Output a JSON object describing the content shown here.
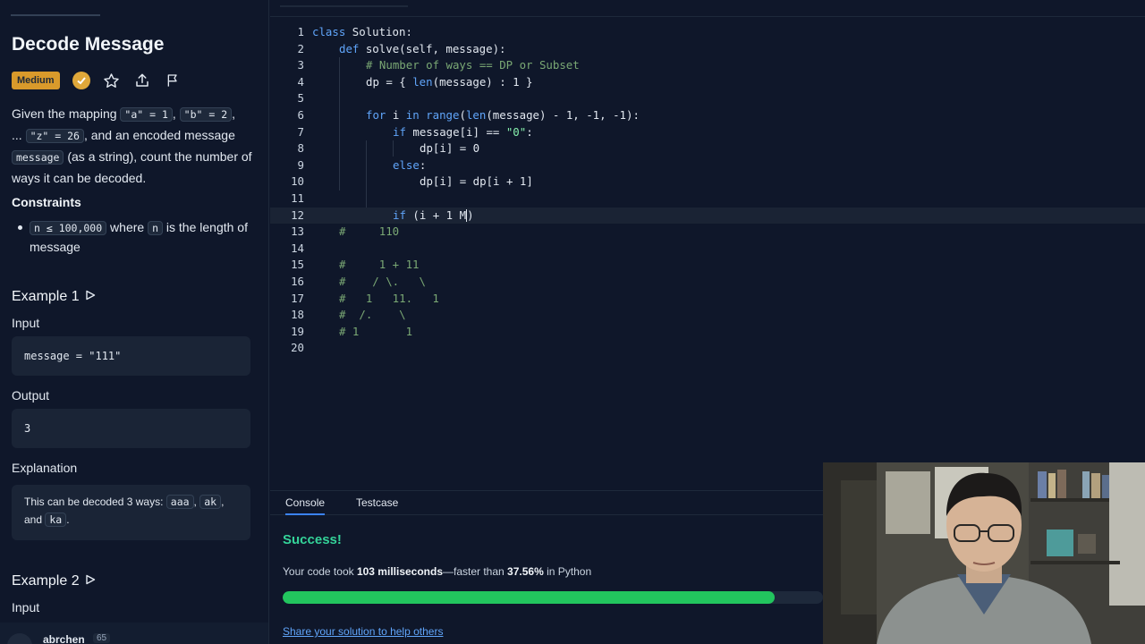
{
  "problem": {
    "title": "Decode Message",
    "difficulty": "Medium",
    "description": {
      "given": "Given the mapping ",
      "map_a": "\"a\" = 1",
      "sep1": ", ",
      "map_b": "\"b\" = 2",
      "sep2": ",",
      "ellipsis": "... ",
      "map_z": "\"z\" = 26",
      "and_encoded": ", and an encoded message ",
      "message_var": "message",
      "rest": " (as a string), count the number of ways it can be decoded."
    },
    "constraints_label": "Constraints",
    "constraint": {
      "n_limit": "n ≤ 100,000",
      "where": " where ",
      "n_var": "n",
      "rest": " is the length of message"
    }
  },
  "example1": {
    "heading": "Example 1",
    "input_label": "Input",
    "input_value": "message = \"111\"",
    "output_label": "Output",
    "output_value": "3",
    "explanation_label": "Explanation",
    "explanation": {
      "text1": "This can be decoded 3 ways: ",
      "w1": "aaa",
      "sep1": ", ",
      "w2": "ak",
      "sep2": ",",
      "and": "and ",
      "w3": "ka",
      "end": "."
    }
  },
  "example2": {
    "heading": "Example 2",
    "input_label": "Input"
  },
  "user": {
    "name": "abrchen",
    "score": "65"
  },
  "editor": {
    "line_numbers": [
      "1",
      "2",
      "3",
      "4",
      "5",
      "6",
      "7",
      "8",
      "9",
      "10",
      "11",
      "12",
      "13",
      "14",
      "15",
      "16",
      "17",
      "18",
      "19",
      "20"
    ],
    "code": {
      "l1_kw": "class",
      "l1_rest": " Solution:",
      "l2_kw": "def",
      "l2_rest": " solve(self, message):",
      "l3": "# Number of ways == DP or Subset",
      "l4a": "dp = { ",
      "l4_fn": "len",
      "l4b": "(message) : 1 }",
      "l6_kw1": "for",
      "l6a": " i ",
      "l6_kw2": "in",
      "l6_fn1": " range",
      "l6b": "(",
      "l6_fn2": "len",
      "l6c": "(message) - 1, -1, -1):",
      "l7_kw": "if",
      "l7a": " message[i] == ",
      "l7_str": "\"0\"",
      "l7b": ":",
      "l8": "dp[i] = 0",
      "l9_kw": "else",
      "l9b": ":",
      "l10": "dp[i] = dp[i + 1]",
      "l12_kw": "if",
      "l12a": " (i + 1 M",
      "l12b": ")",
      "l13": "#     110",
      "l15": "#     1 + 11",
      "l16": "#    / \\.   \\",
      "l17": "#   1   11.   1",
      "l18": "#  /.    \\",
      "l19": "# 1       1"
    }
  },
  "console": {
    "tabs": [
      "Console",
      "Testcase"
    ],
    "status": "Success!",
    "result": {
      "pre": "Your code took ",
      "time": "103 milliseconds",
      "mid": "—faster than ",
      "pct": "37.56%",
      "post": " in Python"
    },
    "progress_percent": 91,
    "progress_color": "#22c55e",
    "share": "Share your solution to help others"
  },
  "colors": {
    "background": "#0f172a",
    "difficulty_badge": "#d99a2b",
    "success": "#34d399",
    "link": "#60a5fa",
    "keyword": "#60a5fa",
    "comment": "#7aa874"
  },
  "icons": {
    "solved": "check-circle-icon",
    "favorite": "star-icon",
    "share": "upload-icon",
    "report": "flag-icon",
    "run_example": "play-icon"
  }
}
